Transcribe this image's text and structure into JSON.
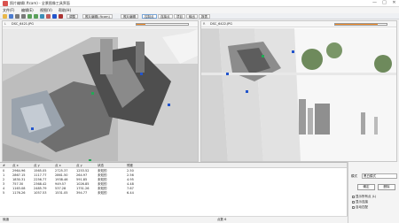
{
  "window": {
    "title": "照片编辑(.ftcam) - 全景图像工具界面",
    "controls": [
      "—",
      "□",
      "✕"
    ]
  },
  "menubar": [
    "文件(F)",
    "编辑(E)",
    "视图(V)",
    "帮助(H)"
  ],
  "toolbar": {
    "tools": [
      "open-icon",
      "save-icon",
      "undo-icon",
      "redo-icon",
      "zoom-in-icon",
      "zoom-out-icon",
      "fit-icon",
      "move-icon",
      "add-point-icon",
      "delete-icon"
    ],
    "tabs": [
      {
        "label": "调整"
      },
      {
        "label": "照片编辑(.ftcam)"
      },
      {
        "label": "照片编辑"
      },
      {
        "label": "控制点"
      },
      {
        "label": "连接点"
      },
      {
        "label": "项目"
      },
      {
        "label": "输出"
      },
      {
        "label": "报表"
      }
    ],
    "active_tab": 3
  },
  "left_image": {
    "id": "L",
    "name": "DSC_6421.JPG",
    "progress": 0.17
  },
  "right_image": {
    "id": "R",
    "name": "DSC_6422.JPG",
    "progress": 0.83
  },
  "table": {
    "headers": [
      "#",
      "点 x",
      "点 y",
      "点 x",
      "点 y",
      "状态",
      "残差"
    ],
    "rows": [
      [
        "0",
        "2964.96",
        "1565.05",
        "2725.37",
        "1253.52",
        "未知的",
        "2.50"
      ],
      [
        "1",
        "2867.15",
        "1117.77",
        "2861.50",
        "264.97",
        "未知的",
        "2.56"
      ],
      [
        "2",
        "1830.31",
        "2256.77",
        "1938.46",
        "591.85",
        "未知的",
        "4.95"
      ],
      [
        "3",
        "757.30",
        "2368.42",
        "949.57",
        "1026.85",
        "未知的",
        "4.48"
      ],
      [
        "4",
        "1163.08",
        "2485.79",
        "537.28",
        "1751.26",
        "未知的",
        "7.67"
      ],
      [
        "5",
        "1176.26",
        "1057.53",
        "1531.05",
        "394.77",
        "未知的",
        "6.44"
      ]
    ]
  },
  "status": {
    "text": "就绪",
    "count": "点数 6"
  },
  "right_panel": {
    "mode_label": "模式",
    "mode_value": "黑白模式",
    "buttons": {
      "ok": "确定",
      "delete": "删除"
    },
    "checkboxes": [
      "显示所有点 (L)",
      "显示连接",
      "自动匹配"
    ]
  },
  "colors": {
    "accent": "#f28c28",
    "marker_blue": "#2255cc",
    "marker_green": "#22aa55"
  }
}
